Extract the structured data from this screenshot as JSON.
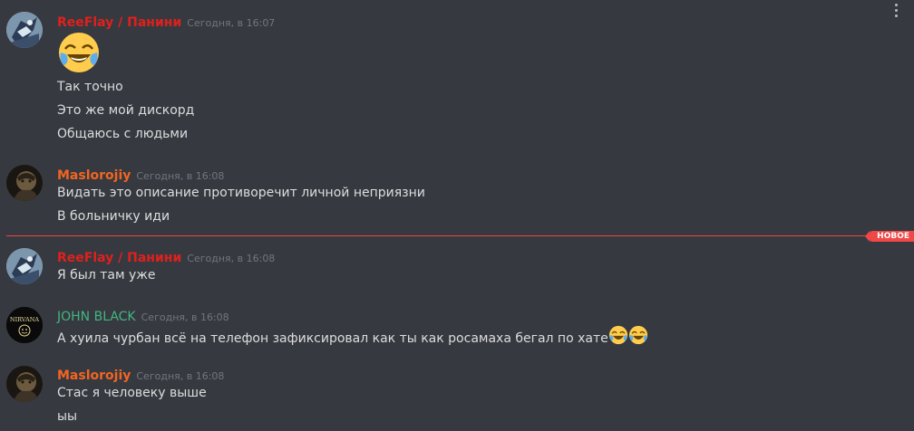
{
  "menu": {
    "icon": "more-vertical-icon"
  },
  "colors": {
    "background": "#36393f",
    "reeflay": "#e0201d",
    "maslorojiy": "#f26522",
    "johnblack": "#43b581",
    "timestamp": "#72767d",
    "new_divider": "#f04747"
  },
  "new_marker": {
    "label": "НОВОЕ"
  },
  "messages": [
    {
      "author": "ReeFlay / Панини",
      "time": "Сегодня, в 16:07",
      "big_emoji": "joy-emoji",
      "lines": [
        "Так точно",
        "Это же мой дискорд",
        "Общаюсь с людьми"
      ]
    },
    {
      "author": "Maslorojiy",
      "time": "Сегодня, в 16:08",
      "lines": [
        "Видать это описание противоречит личной неприязни",
        "В больничку иди"
      ]
    },
    {
      "author": "ReeFlay / Панини",
      "time": "Сегодня, в 16:08",
      "lines": [
        "Я был там уже"
      ]
    },
    {
      "author": "JOHN BLACK",
      "time": "Сегодня, в 16:08",
      "avatar_text": "NIRVANA",
      "lines": [
        "А хуила чурбан всё на телефон зафиксировал как ты как росамаха бегал по хате"
      ],
      "trailing_emoji": [
        "joy-emoji",
        "joy-emoji"
      ]
    },
    {
      "author": "Maslorojiy",
      "time": "Сегодня, в 16:08",
      "lines": [
        "Стас я человеку выше",
        "ыы"
      ]
    }
  ]
}
